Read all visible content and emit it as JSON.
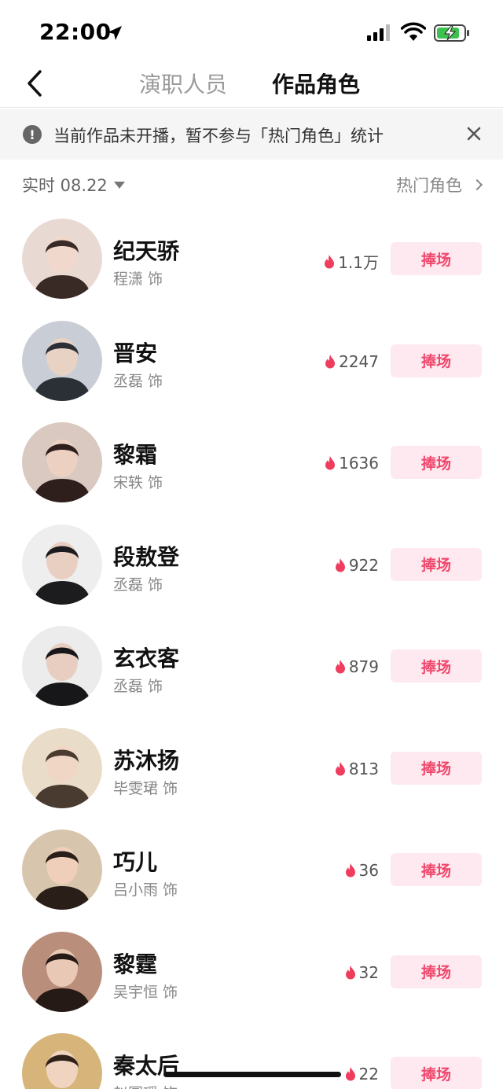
{
  "status_bar": {
    "time": "22:00",
    "icons": [
      "location-arrow-icon",
      "signal-icon",
      "wifi-icon",
      "battery-charging-icon"
    ]
  },
  "header": {
    "back_icon": "chevron-left-icon",
    "tabs": [
      {
        "label": "演职人员",
        "active": false
      },
      {
        "label": "作品角色",
        "active": true
      }
    ]
  },
  "notice": {
    "icon": "info-icon",
    "icon_glyph": "!",
    "text": "当前作品未开播，暂不参与「热门角色」统计",
    "close_glyph": "✕"
  },
  "filter": {
    "left_label": "实时 08.22",
    "right_label": "热门角色"
  },
  "colors": {
    "accent": "#f0486d",
    "button_bg": "#fde9ef",
    "flame": "#ee3d5e"
  },
  "roles": [
    {
      "name": "纪天骄",
      "actor": "程潇 饰",
      "heat": "1.1万",
      "button": "捧场"
    },
    {
      "name": "晋安",
      "actor": "丞磊 饰",
      "heat": "2247",
      "button": "捧场"
    },
    {
      "name": "黎霜",
      "actor": "宋轶 饰",
      "heat": "1636",
      "button": "捧场"
    },
    {
      "name": "段敖登",
      "actor": "丞磊 饰",
      "heat": "922",
      "button": "捧场"
    },
    {
      "name": "玄衣客",
      "actor": "丞磊 饰",
      "heat": "879",
      "button": "捧场"
    },
    {
      "name": "苏沐扬",
      "actor": "毕雯珺 饰",
      "heat": "813",
      "button": "捧场"
    },
    {
      "name": "巧儿",
      "actor": "吕小雨 饰",
      "heat": "36",
      "button": "捧场"
    },
    {
      "name": "黎霆",
      "actor": "吴宇恒 饰",
      "heat": "32",
      "button": "捧场"
    },
    {
      "name": "秦太后",
      "actor": "赵圆瑗 饰",
      "heat": "22",
      "button": "捧场"
    }
  ]
}
